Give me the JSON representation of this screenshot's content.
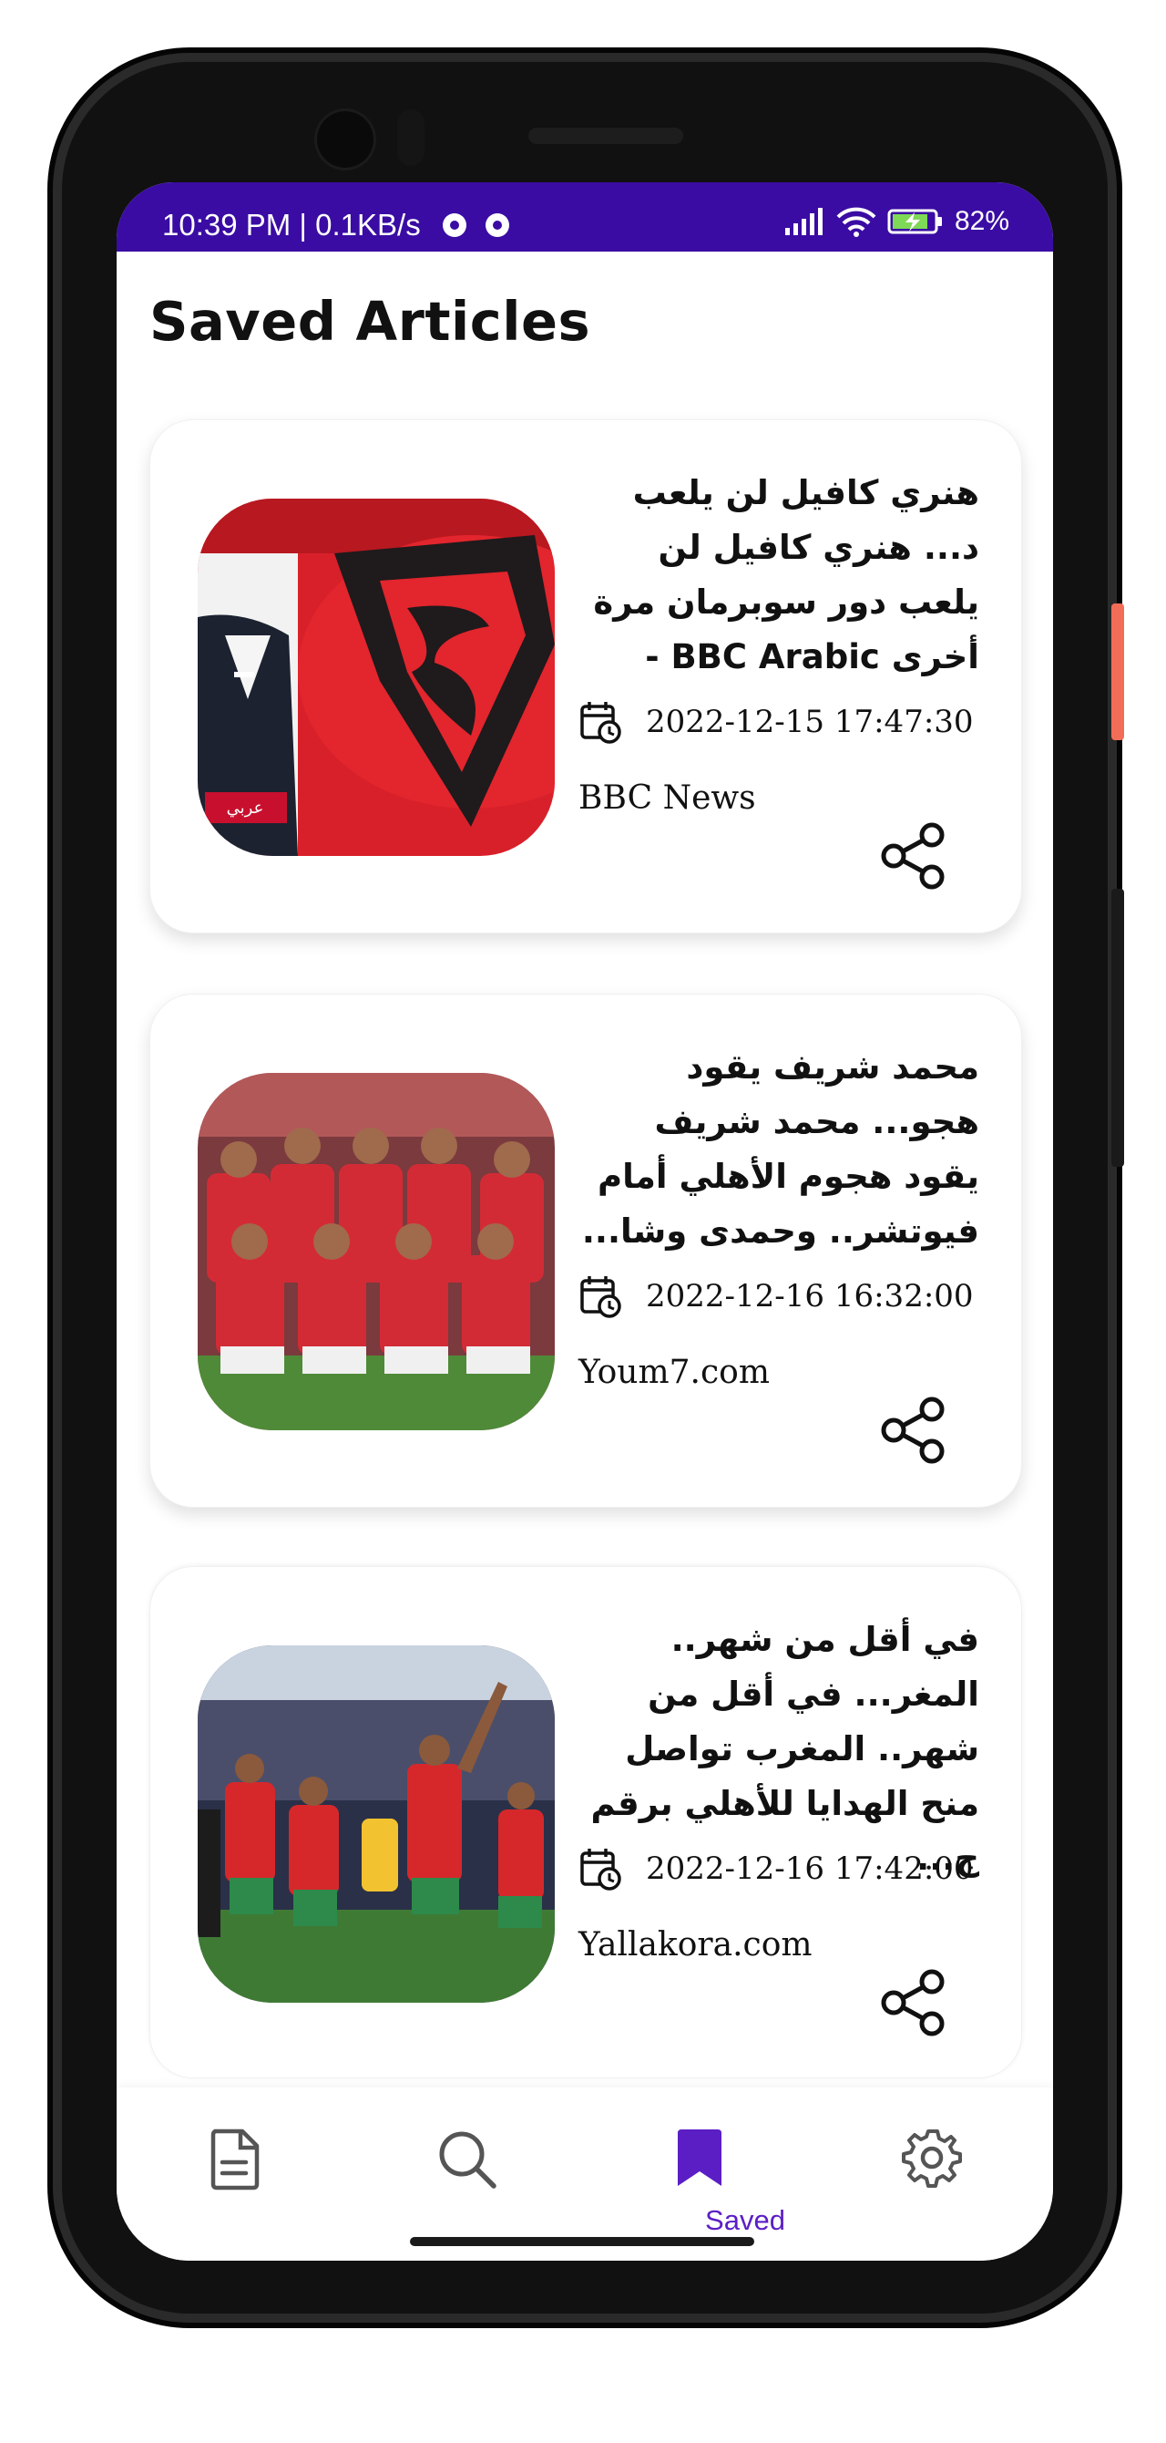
{
  "status_bar": {
    "time_speed": "10:39 PM | 0.1KB/s",
    "battery": "82%",
    "bar_color": "#3a0ca3"
  },
  "page_title": "Saved Articles",
  "articles": [
    {
      "title": "هنري كافيل لن يلعب د... هنري كافيل لن يلعب دور سوبرمان مرة أخرى BBC Arabic -",
      "date": "2022-12-15 17:47:30",
      "source": "BBC News",
      "image_icon": "superman-logo-image",
      "badge": "عربي"
    },
    {
      "title": "محمد شريف يقود هجو... محمد شريف يقود هجوم الأهلي أمام فيوتشر.. وحمدى وشا...",
      "date": "2022-12-16 16:32:00",
      "source": "Youm7.com",
      "image_icon": "football-team-photo"
    },
    {
      "title": "في أقل من شهر.. المغر... في أقل من شهر.. المغرب تواصل منح الهدايا للأهلي برقم ج...",
      "date": "2022-12-16 17:42:00",
      "source": "Yallakora.com",
      "image_icon": "football-celebration-photo"
    }
  ],
  "bottom_nav": {
    "items": [
      {
        "icon": "article-icon",
        "label": ""
      },
      {
        "icon": "search-icon",
        "label": ""
      },
      {
        "icon": "bookmark-icon",
        "label": "Saved"
      },
      {
        "icon": "gear-icon",
        "label": ""
      }
    ],
    "active_color": "#5b1ec5"
  }
}
